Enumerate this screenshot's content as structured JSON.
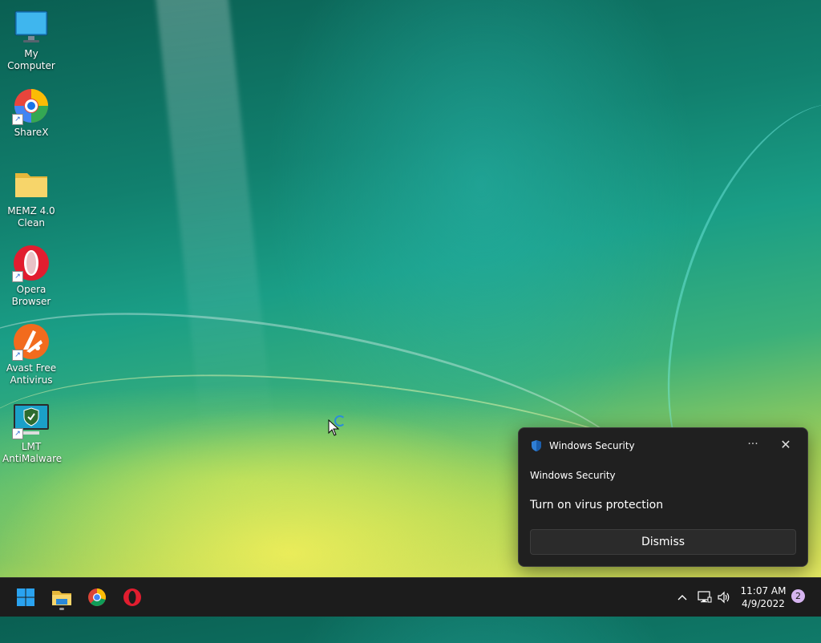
{
  "desktop": {
    "icons": [
      {
        "label": "My Computer",
        "icon": "monitor-icon"
      },
      {
        "label": "ShareX",
        "icon": "sharex-icon"
      },
      {
        "label": "MEMZ 4.0 Clean",
        "icon": "folder-icon"
      },
      {
        "label": "Opera Browser",
        "icon": "opera-icon"
      },
      {
        "label": "Avast Free Antivirus",
        "icon": "avast-icon"
      },
      {
        "label": "LMT AntiMalware",
        "icon": "shield-monitor-icon"
      }
    ]
  },
  "toast": {
    "app_name": "Windows Security",
    "title": "Windows Security",
    "message": "Turn on virus protection",
    "more_label": "···",
    "close_label": "✕",
    "dismiss_label": "Dismiss"
  },
  "taskbar": {
    "pinned": [
      {
        "name": "start",
        "icon": "windows-logo-icon"
      },
      {
        "name": "file-explorer",
        "icon": "folder-icon",
        "running": true
      },
      {
        "name": "chrome",
        "icon": "chrome-icon"
      },
      {
        "name": "opera",
        "icon": "opera-icon"
      }
    ],
    "tray": {
      "chevron_label": "^",
      "network": "network-icon",
      "volume": "volume-icon"
    },
    "clock": {
      "time": "11:07 AM",
      "date": "4/9/2022"
    },
    "notification_count": "2"
  },
  "colors": {
    "taskbar_bg": "#1c1c1c",
    "toast_bg": "#202020",
    "accent": "#2c8dd8"
  }
}
